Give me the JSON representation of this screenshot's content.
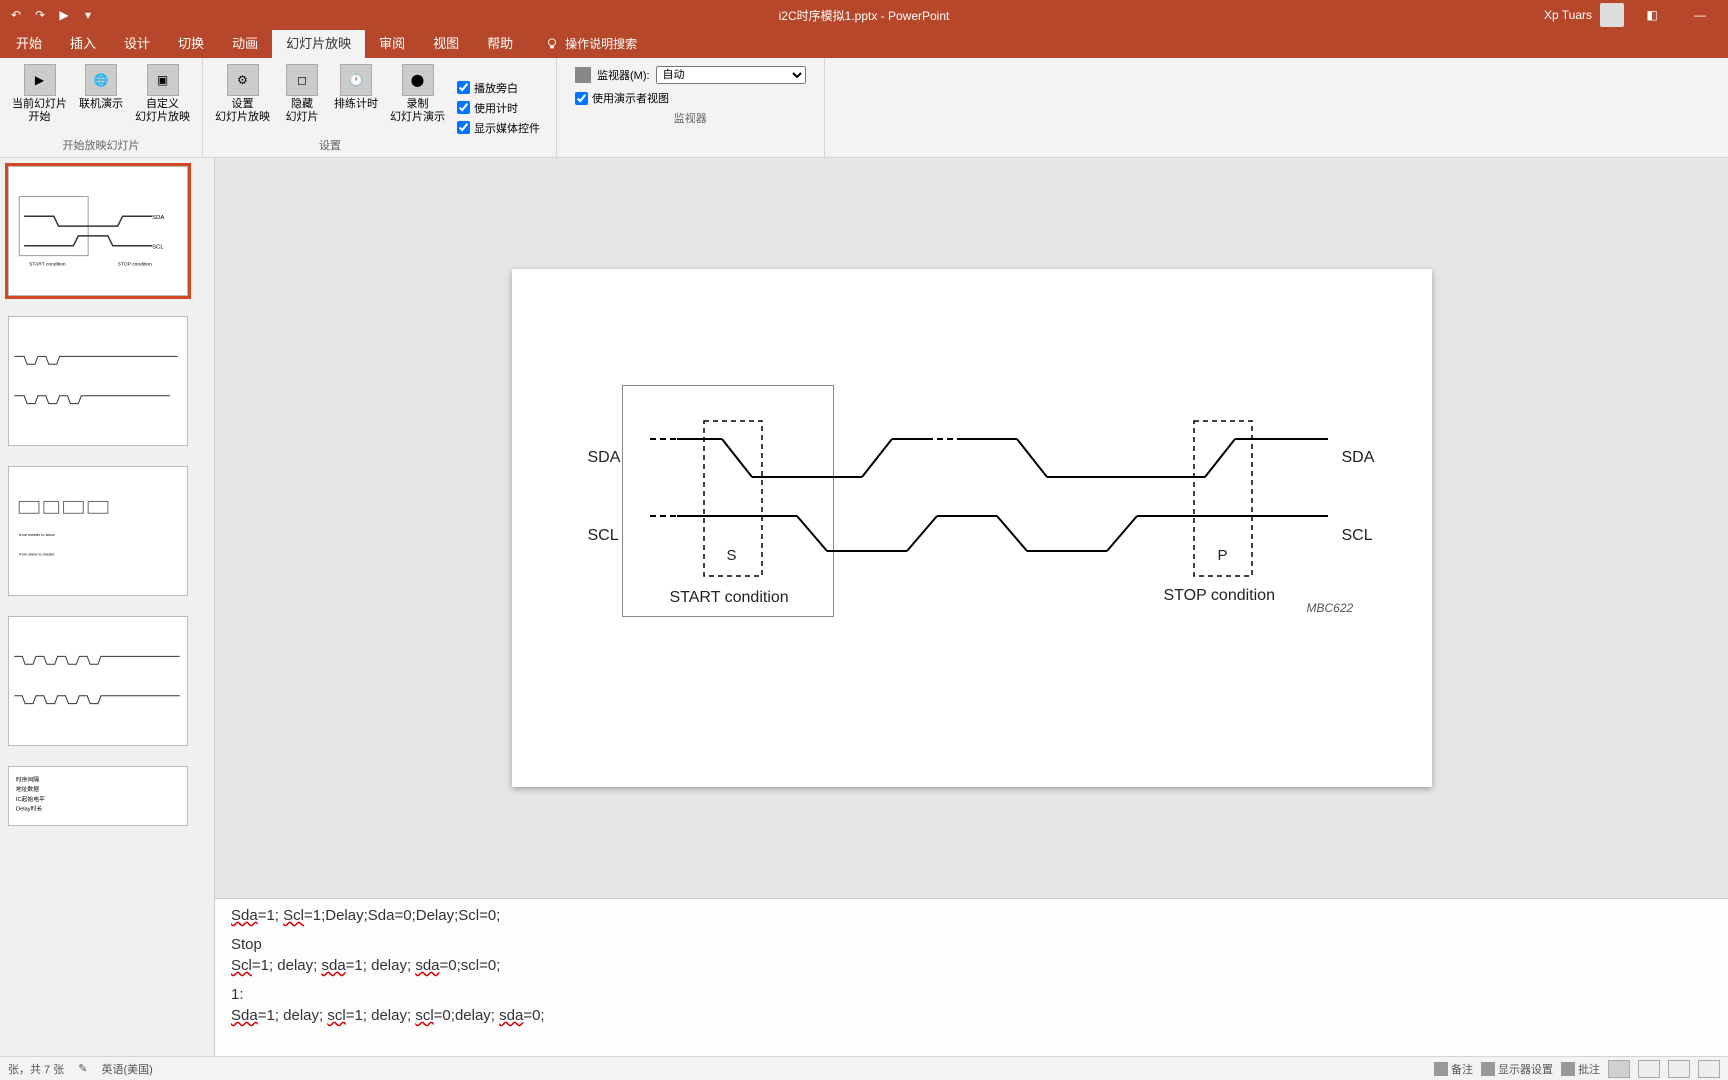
{
  "title": "i2C时序模拟1.pptx - PowerPoint",
  "user": "Xp Tuars",
  "tabs": [
    "开始",
    "插入",
    "设计",
    "切换",
    "动画",
    "幻灯片放映",
    "审阅",
    "视图",
    "帮助"
  ],
  "active_tab_index": 5,
  "tell_me": "操作说明搜索",
  "ribbon": {
    "g1": {
      "label": "开始放映幻灯片",
      "b1": "当前幻灯片\n开始",
      "b2": "联机演示",
      "b3": "自定义\n幻灯片放映"
    },
    "g2": {
      "label": "设置",
      "b1": "设置\n幻灯片放映",
      "b2": "隐藏\n幻灯片",
      "b3": "排练计时",
      "b4": "录制\n幻灯片演示",
      "c1": "播放旁白",
      "c2": "使用计时",
      "c3": "显示媒体控件"
    },
    "g3": {
      "label": "监视器",
      "mon_label": "监视器(M):",
      "mon_value": "自动",
      "presenter": "使用演示者视图"
    }
  },
  "slide": {
    "sda": "SDA",
    "scl": "SCL",
    "s": "S",
    "p": "P",
    "start": "START condition",
    "stop": "STOP condition",
    "mbc": "MBC622"
  },
  "notes": {
    "l1_a": "Sda",
    "l1_b": "=1; ",
    "l1_c": "Scl",
    "l1_d": "=1;Delay;Sda=0;Delay;Scl=0;",
    "l2": "Stop",
    "l3_a": "Scl",
    "l3_b": "=1; delay; ",
    "l3_c": "sda",
    "l3_d": "=1; delay; ",
    "l3_e": "sda",
    "l3_f": "=0;scl=0;",
    "l4": "1:",
    "l5_a": "Sda",
    "l5_b": "=1; delay; ",
    "l5_c": "scl",
    "l5_d": "=1; delay; ",
    "l5_e": "scl",
    "l5_f": "=0;delay; ",
    "l5_g": "sda",
    "l5_h": "=0;"
  },
  "status": {
    "pages": "张，共 7 张",
    "lang": "英语(美国)",
    "notes_btn": "备注",
    "display": "显示器设置",
    "comments": "批注"
  }
}
